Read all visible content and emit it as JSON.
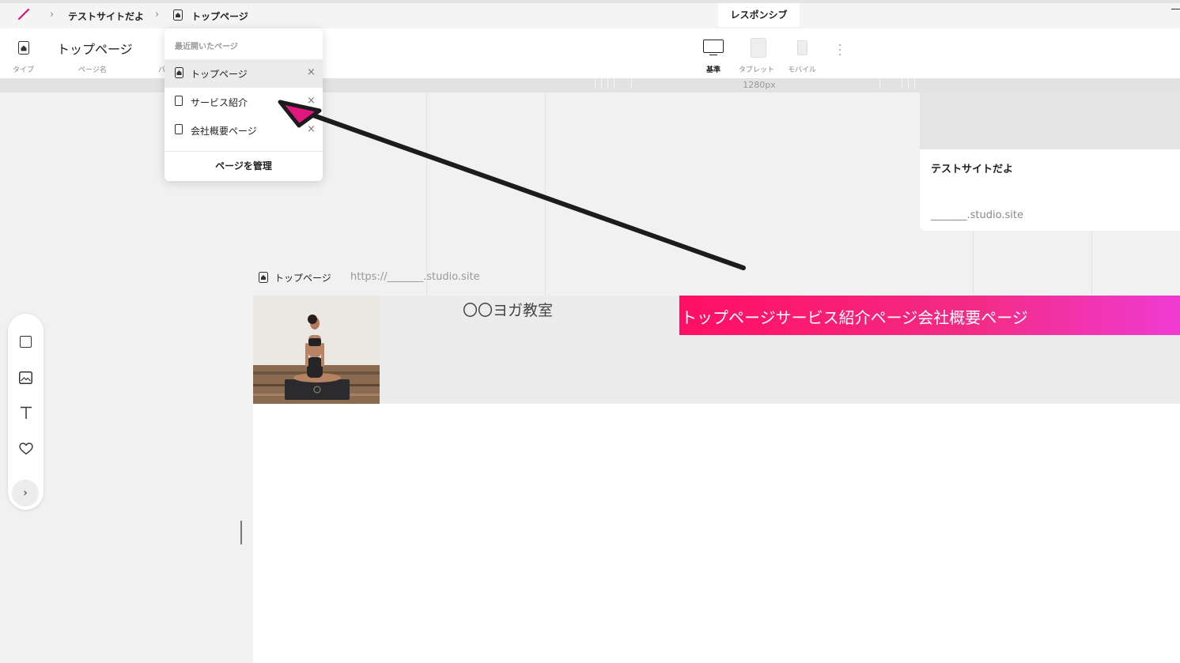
{
  "topbar": {
    "site_name": "テストサイトだよ",
    "page_name": "トップページ",
    "responsive_tab": "レスポンシブ"
  },
  "pagebar": {
    "page_title": "トップページ",
    "type_label": "タイプ",
    "name_label": "ページ名",
    "path_label_partial": "パ",
    "devices": [
      {
        "label": "基準",
        "active": true
      },
      {
        "label": "タブレット",
        "active": false
      },
      {
        "label": "モバイル",
        "active": false
      }
    ]
  },
  "ruler": {
    "width_label": "1280px"
  },
  "dropdown": {
    "header": "最近開いたページ",
    "items": [
      {
        "label": "トップページ",
        "icon": "home-page-icon",
        "selected": true
      },
      {
        "label": "サービス紹介",
        "icon": "document-icon",
        "selected": false
      },
      {
        "label": "会社概要ページ",
        "icon": "document-icon",
        "selected": false
      }
    ],
    "close_glyph": "×",
    "manage_label": "ページを管理"
  },
  "card": {
    "title": "テストサイトだよ",
    "domain": "_______.studio.site"
  },
  "canvas": {
    "page_label": "トップページ",
    "url": "https://_______.studio.site",
    "site_title": "〇〇ヨガ教室",
    "nav_text": "トップページサービス紹介ページ会社概要ページ"
  },
  "colors": {
    "accent": "#e6007e",
    "nav_gradient_start": "#ff0f63",
    "nav_gradient_end": "#f03bd2",
    "arrow": "#1c1c1c"
  }
}
